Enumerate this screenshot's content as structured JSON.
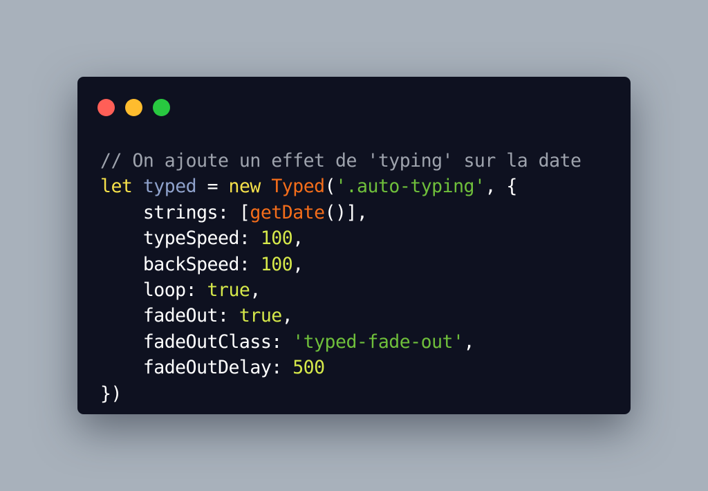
{
  "colors": {
    "background": "#a8b1bb",
    "window": "#0e1120",
    "close_dot": "#ff5f57",
    "minimize_dot": "#febc2e",
    "maximize_dot": "#28c840",
    "comment": "#9ea3ad",
    "keyword": "#f6e14a",
    "variable": "#8fa2cc",
    "class_name": "#f46d1a",
    "string": "#6fbf3b",
    "number": "#d6e94a",
    "plain": "#ffffff"
  },
  "window_controls": [
    "close",
    "minimize",
    "maximize"
  ],
  "code": {
    "language": "javascript",
    "lines": [
      [
        {
          "t": "// On ajoute un effet de 'typing' sur la date",
          "k": "comment"
        }
      ],
      [
        {
          "t": "let",
          "k": "keyword"
        },
        {
          "t": " ",
          "k": "plain"
        },
        {
          "t": "typed",
          "k": "variable"
        },
        {
          "t": " = ",
          "k": "plain"
        },
        {
          "t": "new",
          "k": "keyword"
        },
        {
          "t": " ",
          "k": "plain"
        },
        {
          "t": "Typed",
          "k": "class_name"
        },
        {
          "t": "(",
          "k": "plain"
        },
        {
          "t": "'.auto-typing'",
          "k": "string"
        },
        {
          "t": ", {",
          "k": "plain"
        }
      ],
      [
        {
          "t": "    strings: [",
          "k": "plain"
        },
        {
          "t": "getDate",
          "k": "class_name"
        },
        {
          "t": "()],",
          "k": "plain"
        }
      ],
      [
        {
          "t": "    typeSpeed: ",
          "k": "plain"
        },
        {
          "t": "100",
          "k": "number"
        },
        {
          "t": ",",
          "k": "plain"
        }
      ],
      [
        {
          "t": "    backSpeed: ",
          "k": "plain"
        },
        {
          "t": "100",
          "k": "number"
        },
        {
          "t": ",",
          "k": "plain"
        }
      ],
      [
        {
          "t": "    loop: ",
          "k": "plain"
        },
        {
          "t": "true",
          "k": "number"
        },
        {
          "t": ",",
          "k": "plain"
        }
      ],
      [
        {
          "t": "    fadeOut: ",
          "k": "plain"
        },
        {
          "t": "true",
          "k": "number"
        },
        {
          "t": ",",
          "k": "plain"
        }
      ],
      [
        {
          "t": "    fadeOutClass: ",
          "k": "plain"
        },
        {
          "t": "'typed-fade-out'",
          "k": "string"
        },
        {
          "t": ",",
          "k": "plain"
        }
      ],
      [
        {
          "t": "    fadeOutDelay: ",
          "k": "plain"
        },
        {
          "t": "500",
          "k": "number"
        }
      ],
      [
        {
          "t": "})",
          "k": "plain"
        }
      ]
    ]
  }
}
